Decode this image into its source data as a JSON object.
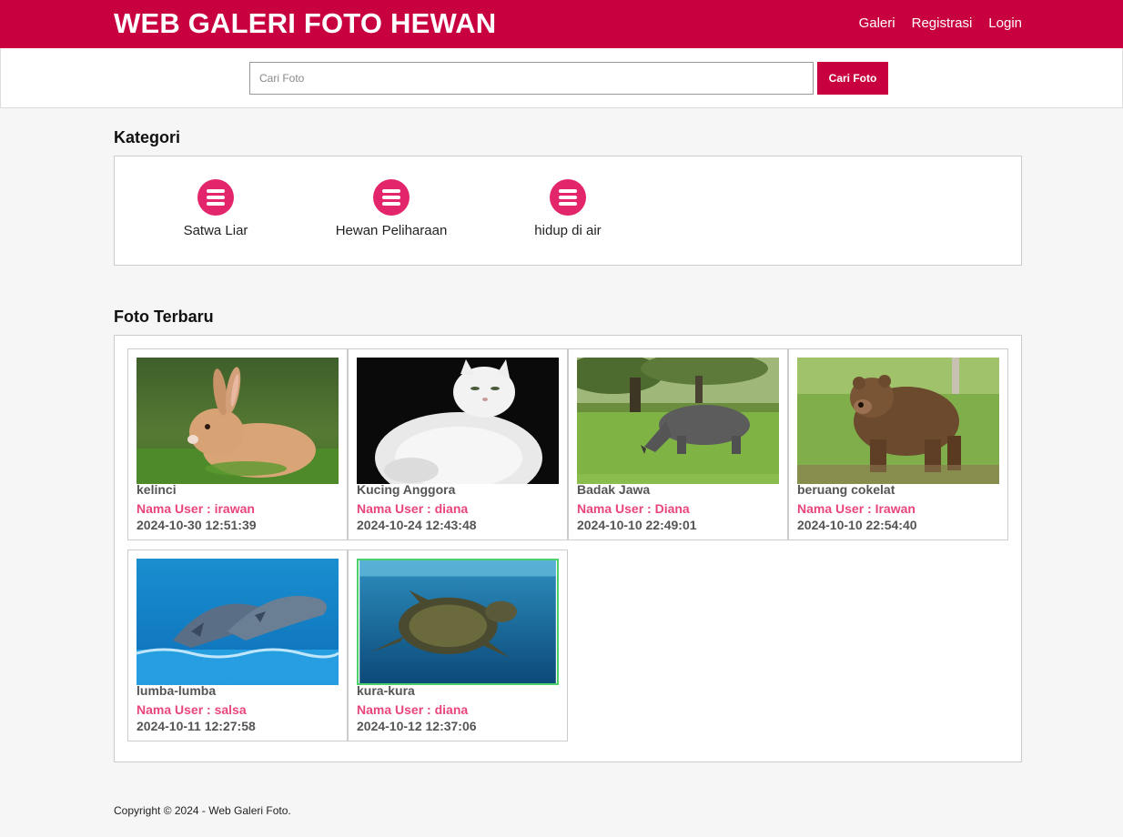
{
  "header": {
    "brand": "WEB GALERI FOTO HEWAN",
    "nav": [
      "Galeri",
      "Registrasi",
      "Login"
    ]
  },
  "search": {
    "placeholder": "Cari Foto",
    "value": "",
    "button_label": "Cari Foto"
  },
  "kategori": {
    "title": "Kategori",
    "items": [
      {
        "label": "Satwa Liar",
        "icon": "list-icon"
      },
      {
        "label": "Hewan Peliharaan",
        "icon": "list-icon"
      },
      {
        "label": "hidup di air",
        "icon": "list-icon"
      }
    ]
  },
  "foto_terbaru": {
    "title": "Foto Terbaru",
    "items": [
      {
        "title": "kelinci",
        "user": "Nama User : irawan",
        "date": "2024-10-30 12:51:39",
        "image": "rabbit-photo"
      },
      {
        "title": "Kucing Anggora",
        "user": "Nama User : diana",
        "date": "2024-10-24 12:43:48",
        "image": "cat-photo"
      },
      {
        "title": "Badak Jawa",
        "user": "Nama User : Diana",
        "date": "2024-10-10 22:49:01",
        "image": "rhino-photo"
      },
      {
        "title": "beruang cokelat",
        "user": "Nama User : Irawan",
        "date": "2024-10-10 22:54:40",
        "image": "bear-photo"
      },
      {
        "title": "lumba-lumba",
        "user": "Nama User : salsa",
        "date": "2024-10-11 12:27:58",
        "image": "dolphin-photo"
      },
      {
        "title": "kura-kura",
        "user": "Nama User : diana",
        "date": "2024-10-12 12:37:06",
        "image": "turtle-photo"
      }
    ]
  },
  "footer": {
    "copyright": "Copyright © 2024 - Web Galeri Foto."
  },
  "colors": {
    "brand": "#c8003f",
    "accent_pink": "#e8457b",
    "icon_pink": "#e3266c"
  }
}
